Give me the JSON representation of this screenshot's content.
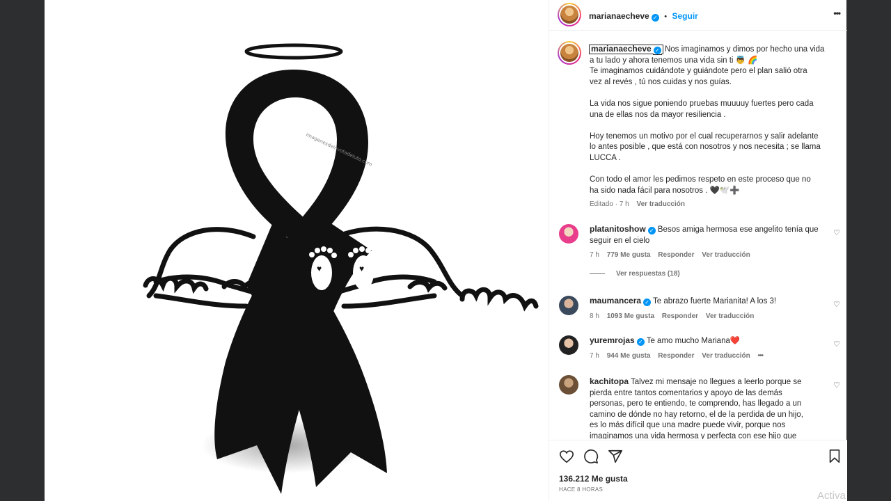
{
  "post": {
    "username": "marianaecheve",
    "follow_label": "Seguir",
    "dot": "•",
    "more": "•••"
  },
  "media": {
    "ribbon_watermark": "imagenesdeinvotadeluto.com"
  },
  "caption": {
    "username": "marianaecheve",
    "lines": [
      "Nos imaginamos y dimos por hecho una vida",
      "a tu lado y ahora tenemos una vida sin ti 👼 🌈",
      "Te imaginamos cuidándote y guiándote pero el plan salió otra",
      "vez al revés , tú nos cuidas y nos guías.",
      "",
      "La vida nos sigue poniendo pruebas muuuuy fuertes pero cada",
      "una de ellas nos da mayor resiliencia .",
      "",
      "Hoy tenemos un motivo por el cual recuperarnos y salir adelante",
      "lo antes posible , que está con nosotros y nos necesita ; se llama",
      "LUCCA .",
      "",
      "Con todo el amor les pedimos respeto en este proceso que no",
      "ha sido nada fácil para nosotros . 🖤🕊️➕"
    ],
    "edited": "Editado · 7 h",
    "translate": "Ver traducción"
  },
  "comments": [
    {
      "username": "platanitoshow",
      "text_lines": [
        "Besos amiga hermosa ese angelito tenía que",
        "seguir en el cielo"
      ],
      "time": "7 h",
      "likes": "779 Me gusta",
      "reply": "Responder",
      "translate": "Ver traducción",
      "view_replies": "Ver respuestas (18)"
    },
    {
      "username": "maumancera",
      "text_lines": [
        "Te abrazo fuerte Marianita! A los 3!"
      ],
      "time": "8 h",
      "likes": "1093 Me gusta",
      "reply": "Responder",
      "translate": "Ver traducción"
    },
    {
      "username": "yuremrojas",
      "text_lines": [
        "Te amo mucho Mariana❤️"
      ],
      "time": "7 h",
      "likes": "944 Me gusta",
      "reply": "Responder",
      "translate": "Ver traducción",
      "more": "•••"
    },
    {
      "username": "kachitopa",
      "text_lines": [
        "Talvez mi mensaje no llegues a leerlo porque se",
        "pierda entre tantos comentarios y apoyo de las demás",
        "personas, pero te entiendo, te comprendo, has llegado a un",
        "camino de dónde no hay retorno, el de la perdida de un hijo,",
        "es lo más difícil que una madre puede vivir, porque nos",
        "imaginamos una vida hermosa y perfecta con ese hijo que"
      ]
    }
  ],
  "footer": {
    "likes": "136.212 Me gusta",
    "time": "HACE 8 HORAS"
  },
  "os_watermark": "Activa",
  "colors": {
    "accent": "#0095f6",
    "background": "#2d2e30",
    "text": "#262626",
    "secondary": "#737373"
  }
}
